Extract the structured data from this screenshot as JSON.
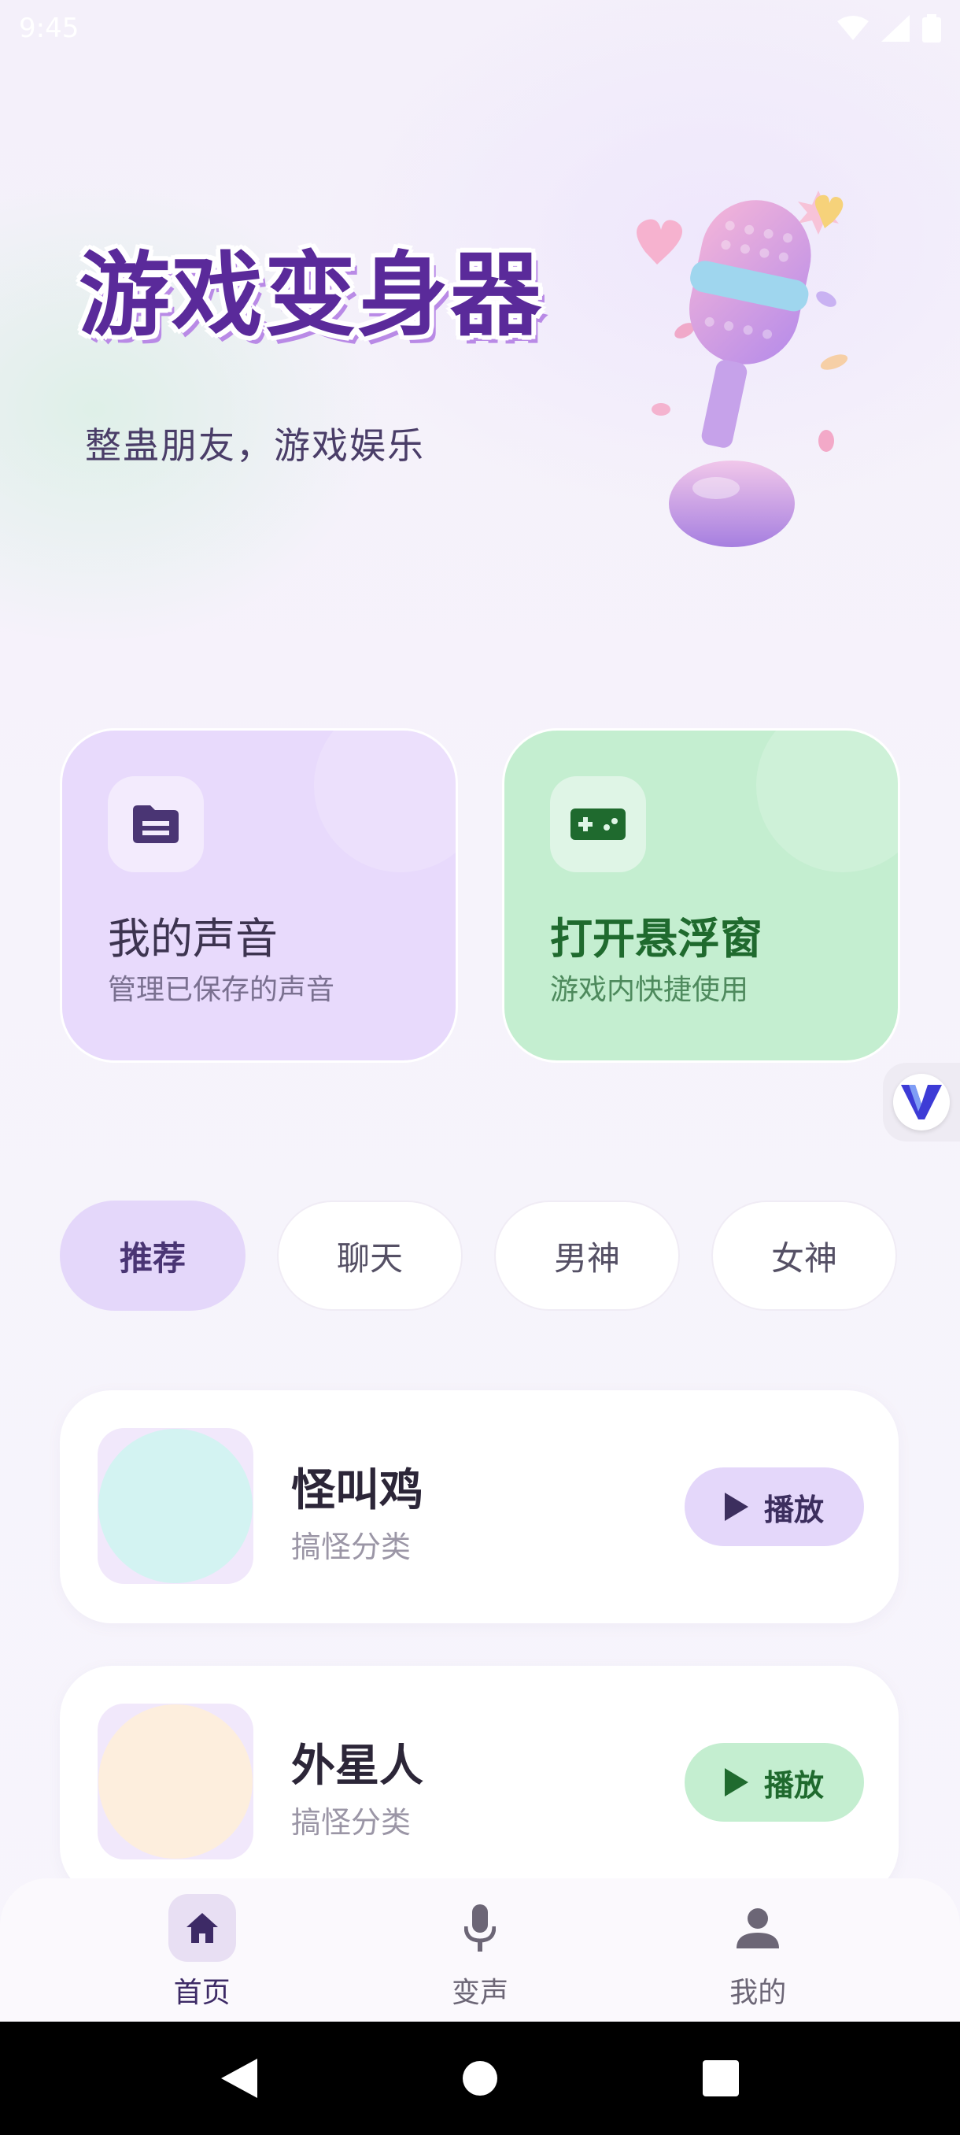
{
  "status_bar": {
    "time": "9:45"
  },
  "banner": {
    "title": "游戏变身器",
    "subtitle": "整蛊朋友，游戏娱乐"
  },
  "quick_actions": [
    {
      "title": "我的声音",
      "desc": "管理已保存的声音",
      "icon": "folder-icon"
    },
    {
      "title": "打开悬浮窗",
      "desc": "游戏内快捷使用",
      "icon": "gamepad-icon"
    }
  ],
  "categories": [
    "推荐",
    "聊天",
    "男神",
    "女神"
  ],
  "selected_category": "推荐",
  "voices": [
    {
      "name": "怪叫鸡",
      "category": "搞怪分类",
      "play_label": "播放"
    },
    {
      "name": "外星人",
      "category": "搞怪分类",
      "play_label": "播放"
    }
  ],
  "bottom_nav": [
    {
      "label": "首页",
      "icon": "home-icon",
      "active": true
    },
    {
      "label": "变声",
      "icon": "microphone-icon",
      "active": false
    },
    {
      "label": "我的",
      "icon": "person-icon",
      "active": false
    }
  ],
  "colors": {
    "accent_purple": "#e4d7fa",
    "accent_green": "#c4eed0",
    "title_purple": "#5a2a9a",
    "text_green": "#1f6a2e"
  }
}
